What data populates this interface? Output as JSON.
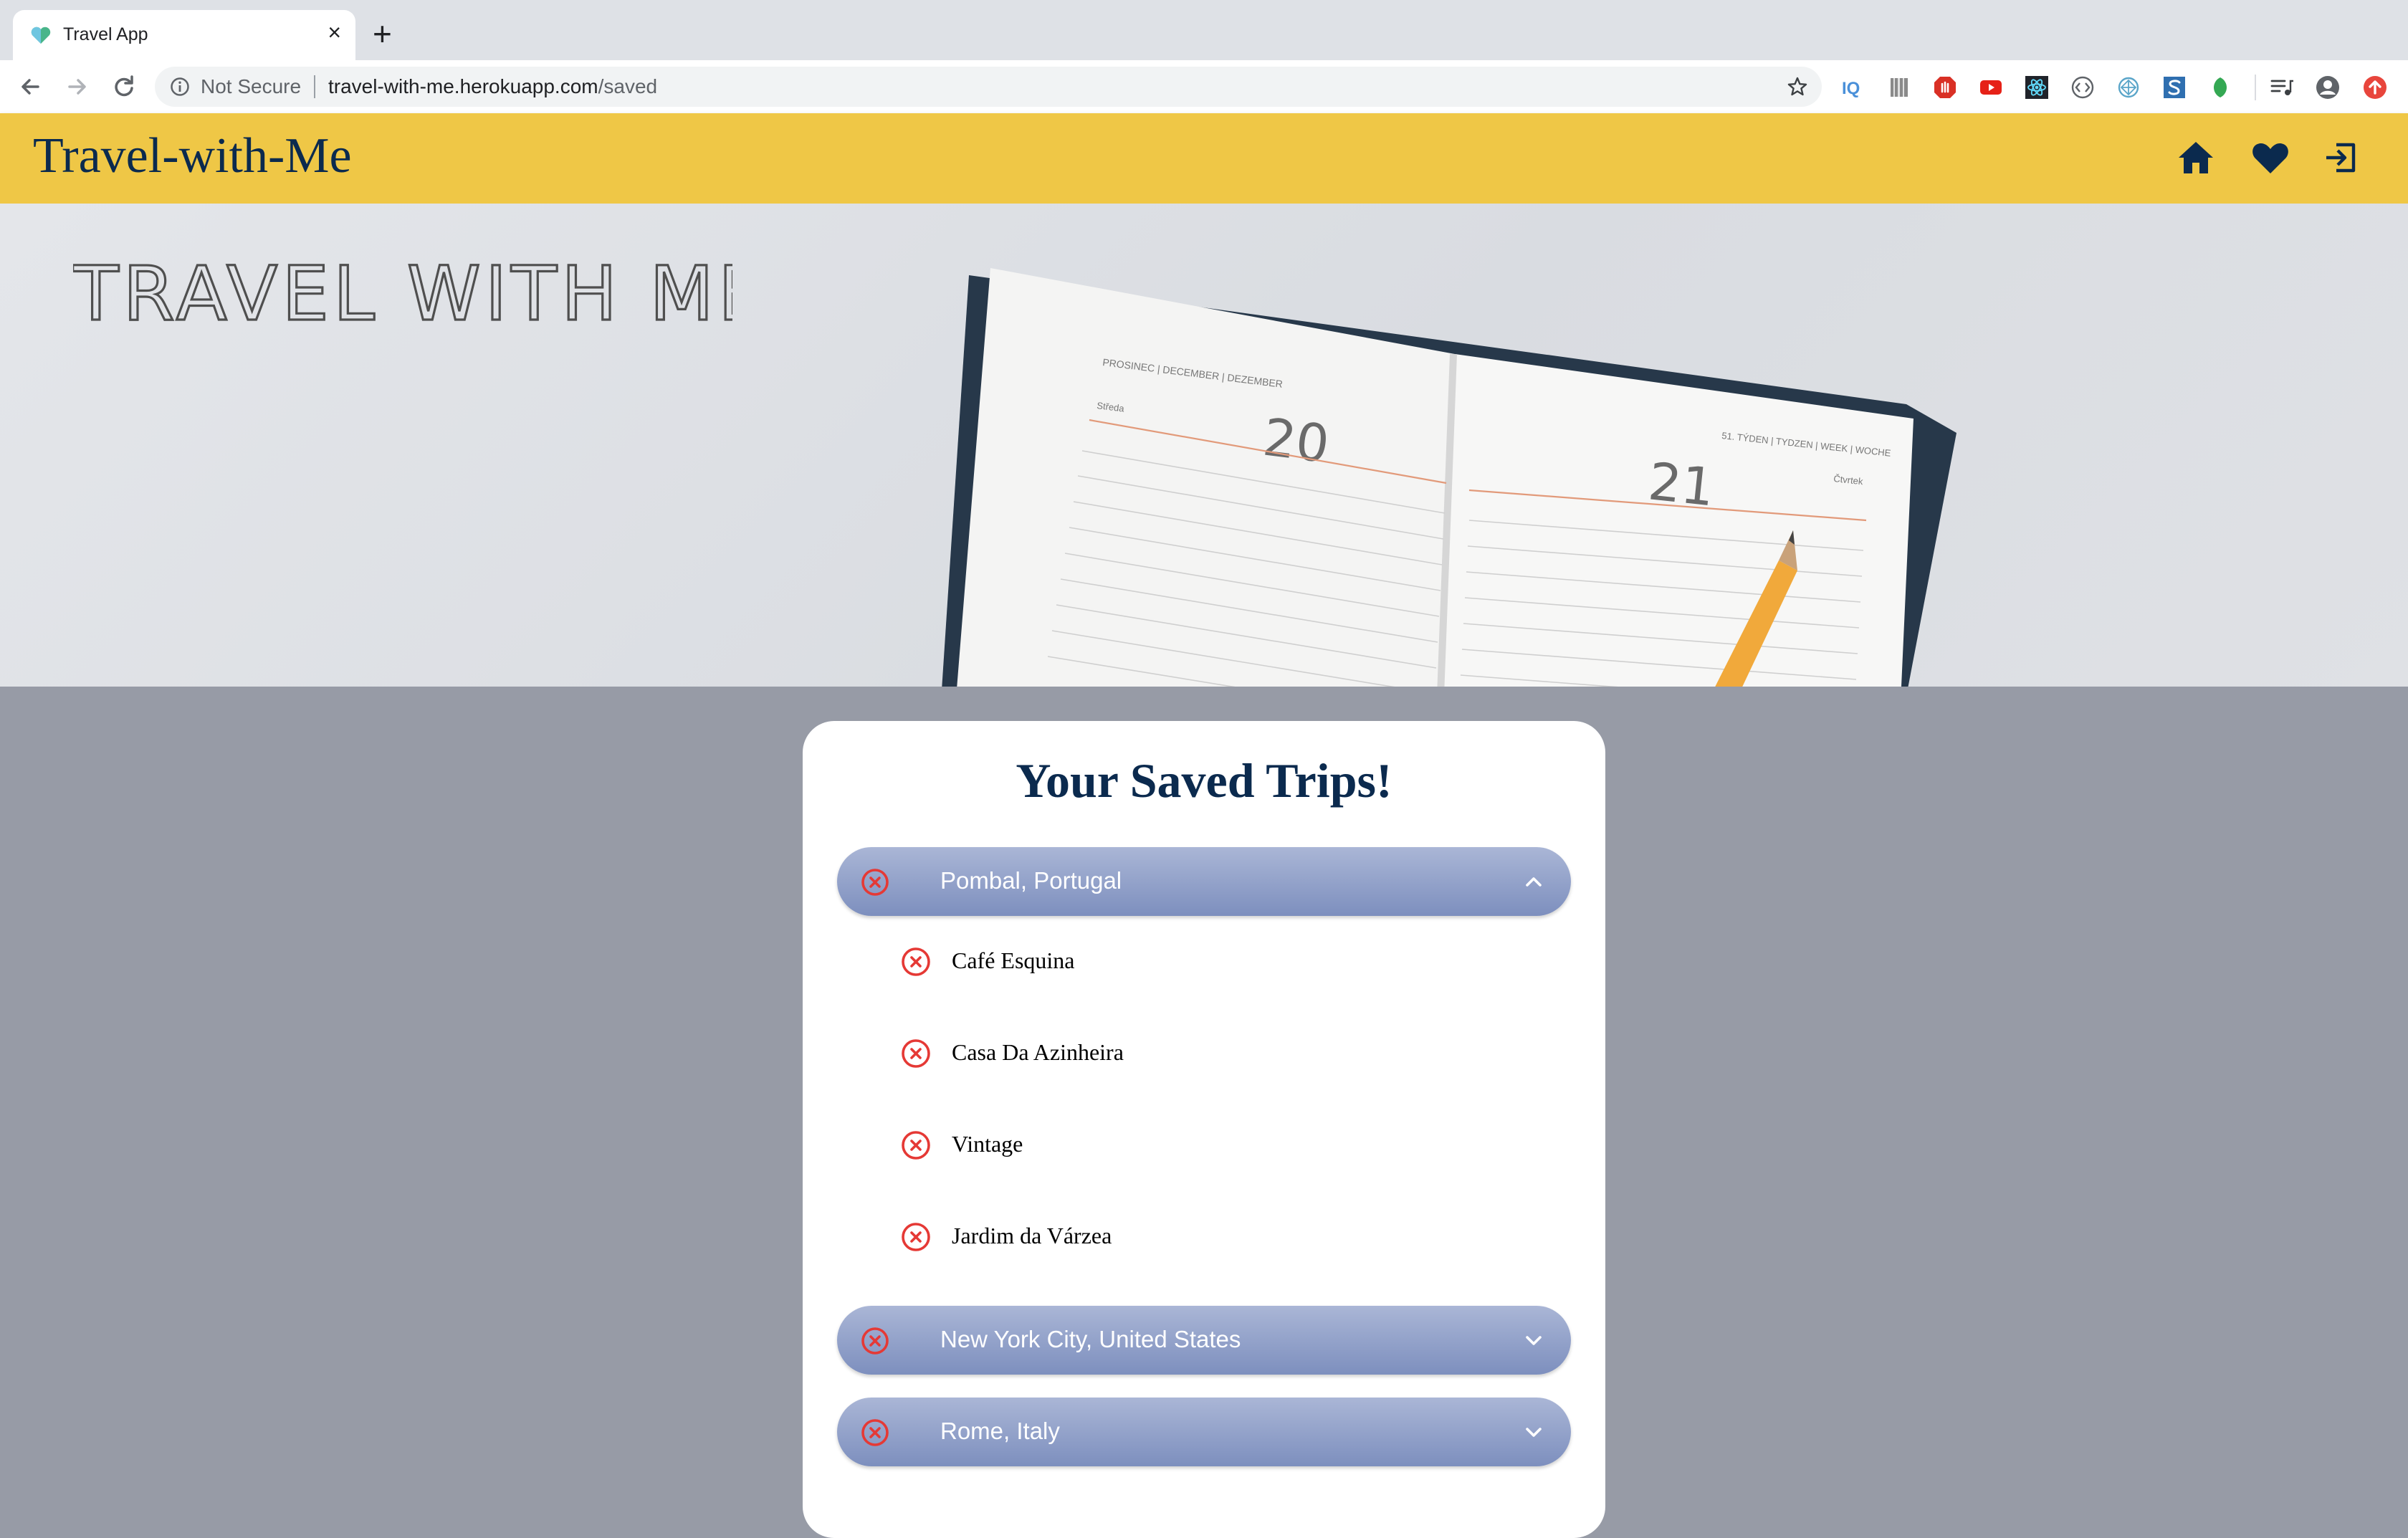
{
  "browser": {
    "tab_title": "Travel App",
    "new_tab_symbol": "+",
    "close_symbol": "×",
    "security_label": "Not Secure",
    "url_host": "travel-with-me.herokuapp.com",
    "url_path": "/saved",
    "icons": [
      "back-icon",
      "forward-icon",
      "reload-icon",
      "info-icon",
      "bookmark-star-icon"
    ],
    "extensions": [
      "iq-extension-icon",
      "barcode-extension-icon",
      "adblock-extension-icon",
      "youtube-extension-icon",
      "react-devtools-icon",
      "code-extension-icon",
      "sync-extension-icon",
      "s-extension-icon",
      "green-leaf-extension-icon",
      "reading-list-icon",
      "profile-icon",
      "update-icon"
    ]
  },
  "app": {
    "brand": "Travel-with-Me",
    "nav": {
      "home": "home-icon",
      "saved": "heart-icon",
      "logout": "logout-icon"
    },
    "colors": {
      "header_bg": "#efc746",
      "brand_text": "#0b2a4e",
      "page_bg": "#979ba6",
      "accordion_top": "#aab6d6",
      "accordion_bottom": "#7d8fbe",
      "remove_red": "#e53935"
    }
  },
  "hero": {
    "title": "TRAVEL WITH ME",
    "planner_day_left": "20",
    "planner_day_right": "21",
    "planner_header_left": "PROSINEC | DECEMBER | DEZEMBER",
    "planner_weekday_left": "Středa",
    "planner_week_right": "51. TÝDEN | TYDZEN | WEEK | WOCHE",
    "planner_weekday_right": "Čtvrtek"
  },
  "saved": {
    "heading": "Your Saved Trips!",
    "trips": [
      {
        "name": "Pombal, Portugal",
        "expanded": true,
        "places": [
          "Café Esquina",
          "Casa Da Azinheira",
          "Vintage",
          "Jardim da Várzea"
        ]
      },
      {
        "name": "New York City, United States",
        "expanded": false,
        "places": []
      },
      {
        "name": "Rome, Italy",
        "expanded": false,
        "places": []
      }
    ]
  }
}
